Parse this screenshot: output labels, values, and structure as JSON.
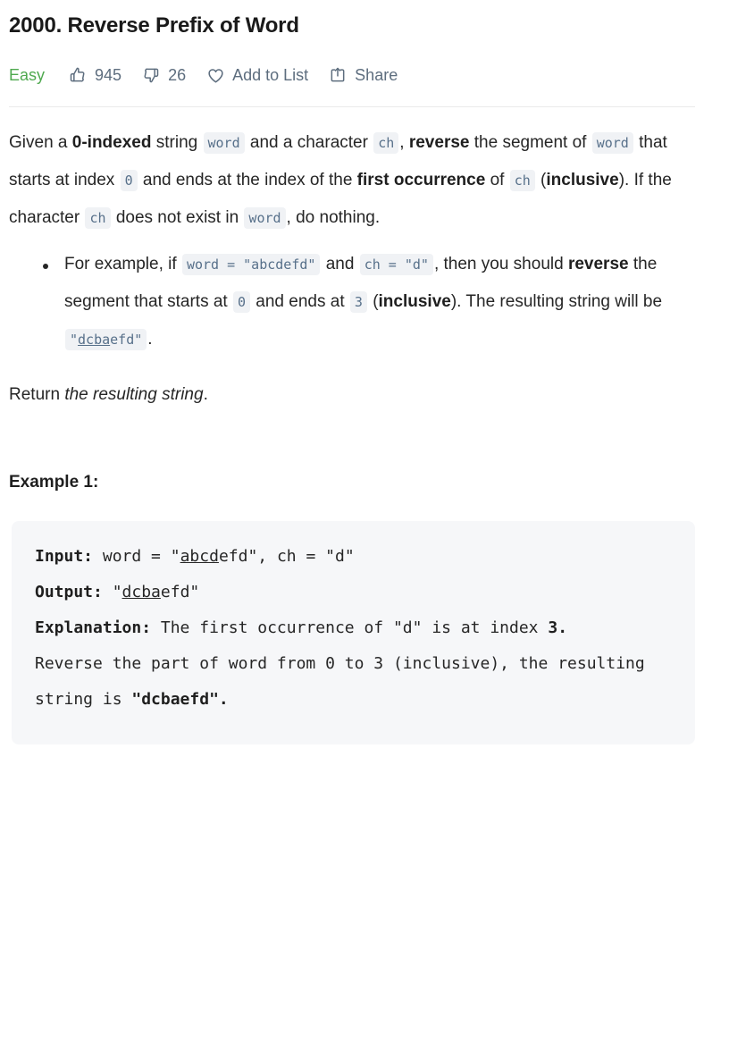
{
  "problem": {
    "title": "2000. Reverse Prefix of Word",
    "difficulty": "Easy",
    "difficulty_color": "#4fa94f"
  },
  "actions": {
    "likes_icon": "thumbs-up-icon",
    "likes": "945",
    "dislikes_icon": "thumbs-down-icon",
    "dislikes": "26",
    "favorite_icon": "heart-icon",
    "favorite_label": "Add to List",
    "share_icon": "share-icon",
    "share_label": "Share"
  },
  "description": {
    "p1": {
      "t1": "Given a ",
      "b1": "0-indexed",
      "t2": " string ",
      "c1": "word",
      "t3": " and a character ",
      "c2": "ch",
      "t4": ", ",
      "b2": "reverse",
      "t5": " the segment of ",
      "c3": "word",
      "t6": " that starts at index ",
      "c4": "0",
      "t7": " and ends at the index of the ",
      "b3": "first occurrence",
      "t8": " of ",
      "c5": "ch",
      "t9": " (",
      "b4": "inclusive",
      "t10": "). If the character ",
      "c6": "ch",
      "t11": " does not exist in ",
      "c7": "word",
      "t12": ", do nothing."
    },
    "bullet1": {
      "t1": "For example, if ",
      "c1": "word = \"abcdefd\"",
      "t2": " and ",
      "c2": "ch = \"d\"",
      "t3": ", then you should ",
      "b1": "reverse",
      "t4": " the segment that starts at ",
      "c3": "0",
      "t5": " and ends at ",
      "c4": "3",
      "t6": " (",
      "b2": "inclusive",
      "t7": "). The resulting string will be ",
      "c5_pre": "\"",
      "c5_underline": "dcba",
      "c5_post": "efd\"",
      "t8": "."
    },
    "p2": {
      "t1": "Return ",
      "i1": "the resulting string",
      "t2": "."
    }
  },
  "example1": {
    "heading": "Example 1:",
    "input_label": "Input:",
    "input_pre": " word = \"",
    "input_underline": "abcd",
    "input_post": "efd\", ch = \"d\"",
    "output_label": "Output:",
    "output_pre": " \"",
    "output_underline": "dcba",
    "output_post": "efd\"",
    "explanation_label": "Explanation:",
    "explanation_t1": " The first occurrence of \"d\" is at index ",
    "explanation_b1": "3.",
    "explanation_t2": "\nReverse the part of word from 0 to 3 (inclusive), the resulting string is ",
    "explanation_b2": "\"dcbaefd\"."
  }
}
